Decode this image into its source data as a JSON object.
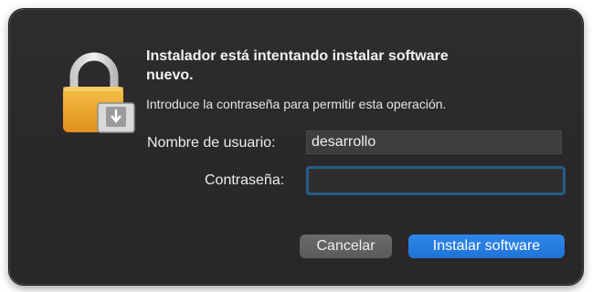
{
  "dialog": {
    "headline": "Instalador está intentando instalar software nuevo.",
    "message": "Introduce la contraseña para permitir esta operación.",
    "icon": "lock-icon"
  },
  "form": {
    "username_label": "Nombre de usuario:",
    "username_value": "desarrollo",
    "password_label": "Contraseña:",
    "password_value": ""
  },
  "buttons": {
    "cancel_label": "Cancelar",
    "confirm_label": "Instalar software"
  },
  "colors": {
    "accent": "#2a7de1",
    "focus_ring": "#255e86",
    "lock_gold": "#e9a12c"
  }
}
